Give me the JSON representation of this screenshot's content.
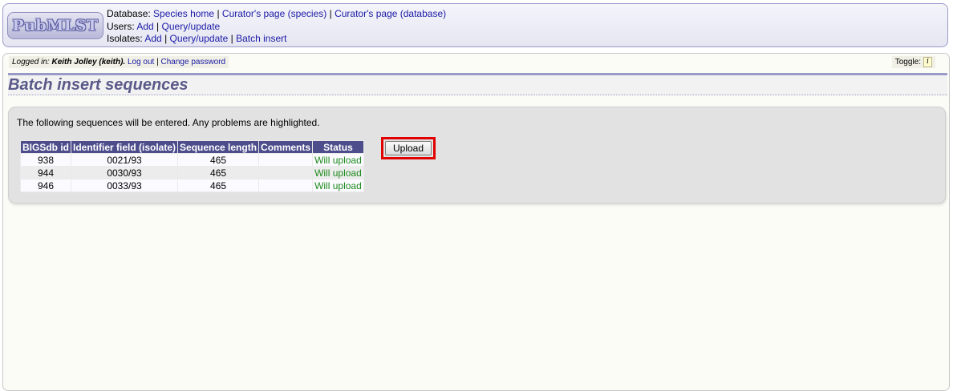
{
  "header": {
    "logo_text": "PubMLST",
    "database_label": "Database:",
    "database_links": [
      "Species home",
      "Curator's page (species)",
      "Curator's page (database)"
    ],
    "users_label": "Users:",
    "users_links": [
      "Add",
      "Query/update"
    ],
    "isolates_label": "Isolates:",
    "isolates_links": [
      "Add",
      "Query/update",
      "Batch insert"
    ]
  },
  "userbar": {
    "logged_in_label": "Logged in:",
    "user": "Keith Jolley (keith).",
    "logout": "Log out",
    "change_password": "Change password"
  },
  "toggle": {
    "label": "Toggle:",
    "icon_text": "i"
  },
  "page_title": "Batch insert sequences",
  "message": "The following sequences will be entered. Any problems are highlighted.",
  "table": {
    "columns": [
      "BIGSdb id",
      "Identifier field (isolate)",
      "Sequence length",
      "Comments",
      "Status"
    ],
    "rows": [
      [
        "938",
        "0021/93",
        "465",
        "",
        "Will upload"
      ],
      [
        "944",
        "0030/93",
        "465",
        "",
        "Will upload"
      ],
      [
        "946",
        "0033/93",
        "465",
        "",
        "Will upload"
      ]
    ]
  },
  "upload_button": "Upload",
  "colors": {
    "header_border": "#9a9ac8",
    "table_header": "#4d4d8c",
    "status_ok": "#1d8a1d",
    "highlight": "#e00000"
  }
}
